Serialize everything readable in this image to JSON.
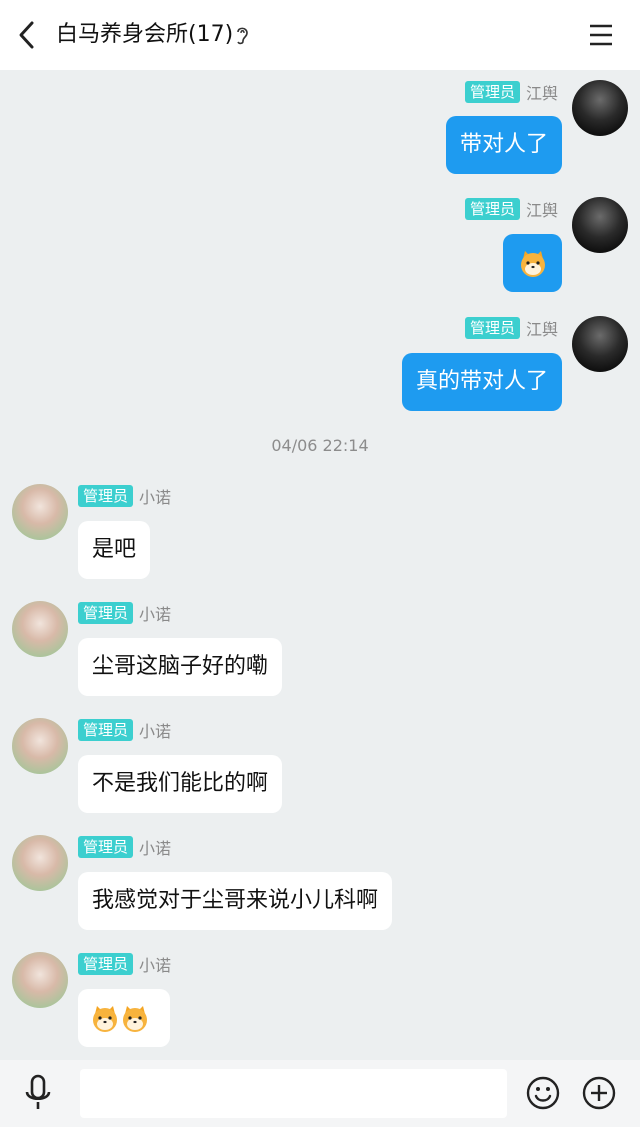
{
  "header": {
    "title": "白马养身会所(17)",
    "back_icon": "chevron-left-icon",
    "ear_icon": "ear-icon",
    "menu_icon": "hamburger-menu-icon"
  },
  "colors": {
    "bubble_self": "#1e9bf0",
    "bubble_other": "#ffffff",
    "badge": "#3ccfcf",
    "background": "#eceff0"
  },
  "messages_sent": [
    {
      "badge": "管理员",
      "sender": "江舆",
      "text": "带对人了"
    },
    {
      "badge": "管理员",
      "sender": "江舆",
      "text": "",
      "emoji": "shiba-dog-emoji"
    },
    {
      "badge": "管理员",
      "sender": "江舆",
      "text": "真的带对人了"
    }
  ],
  "timestamp": "04/06 22:14",
  "messages_received": [
    {
      "badge": "管理员",
      "sender": "小诺",
      "text": "是吧"
    },
    {
      "badge": "管理员",
      "sender": "小诺",
      "text": "尘哥这脑子好的嘞"
    },
    {
      "badge": "管理员",
      "sender": "小诺",
      "text": "不是我们能比的啊"
    },
    {
      "badge": "管理员",
      "sender": "小诺",
      "text": "我感觉对于尘哥来说小儿科啊"
    },
    {
      "badge": "管理员",
      "sender": "小诺",
      "text": "",
      "emoji": "shiba-dog-emoji x2"
    }
  ],
  "input_bar": {
    "placeholder": "",
    "mic_icon": "microphone-icon",
    "emoji_icon": "smiley-icon",
    "plus_icon": "plus-circle-icon"
  }
}
